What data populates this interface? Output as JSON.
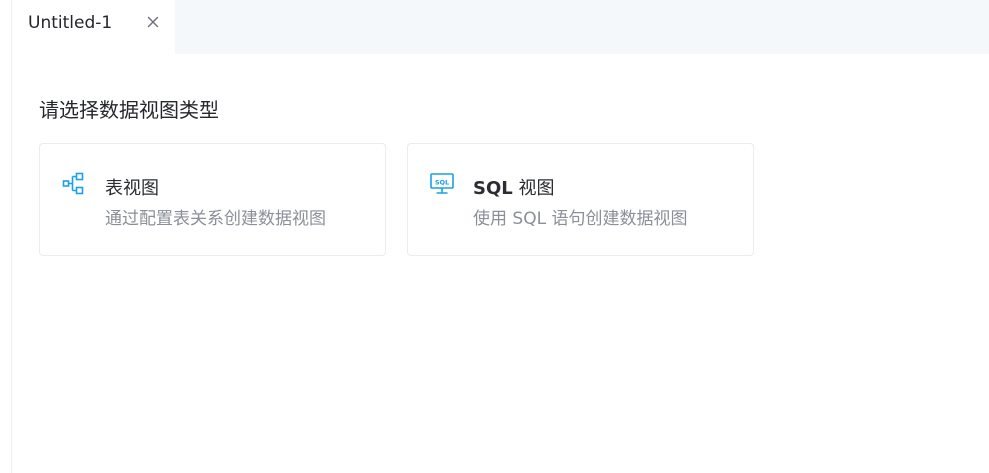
{
  "tab": {
    "title": "Untitled-1"
  },
  "main": {
    "heading": "请选择数据视图类型",
    "cards": [
      {
        "icon": "table-relation-icon",
        "title": "表视图",
        "description": "通过配置表关系创建数据视图"
      },
      {
        "icon": "sql-monitor-icon",
        "title_bold": "SQL",
        "title_rest": " 视图",
        "description": "使用 SQL 语句创建数据视图"
      }
    ]
  },
  "colors": {
    "accent": "#1aa0e6",
    "tab_bar_bg": "#f5f8fb",
    "border": "#e9ecf1",
    "muted_text": "#8a8f99"
  }
}
